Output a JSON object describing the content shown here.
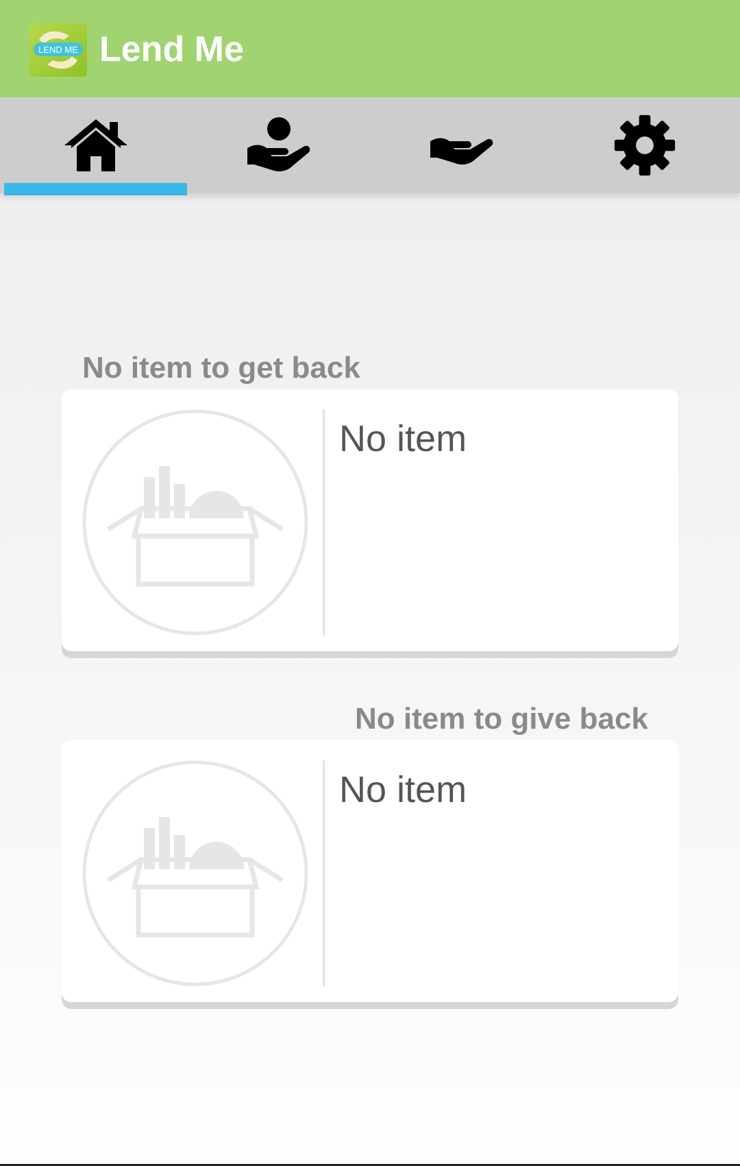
{
  "app": {
    "title": "Lend Me",
    "logo_text": "LEND ME",
    "brand_color": "#a1d470",
    "accent_color": "#39b7e6"
  },
  "tabs": [
    {
      "icon": "home-icon",
      "selected": true
    },
    {
      "icon": "borrow-hand-icon",
      "selected": false
    },
    {
      "icon": "lend-hand-icon",
      "selected": false
    },
    {
      "icon": "gear-icon",
      "selected": false
    }
  ],
  "sections": {
    "get_back": {
      "label": "No item to get back",
      "item": {
        "name": "No item",
        "icon": "empty-box-icon"
      }
    },
    "give_back": {
      "label": "No item to give back",
      "item": {
        "name": "No item",
        "icon": "empty-box-icon"
      }
    }
  }
}
